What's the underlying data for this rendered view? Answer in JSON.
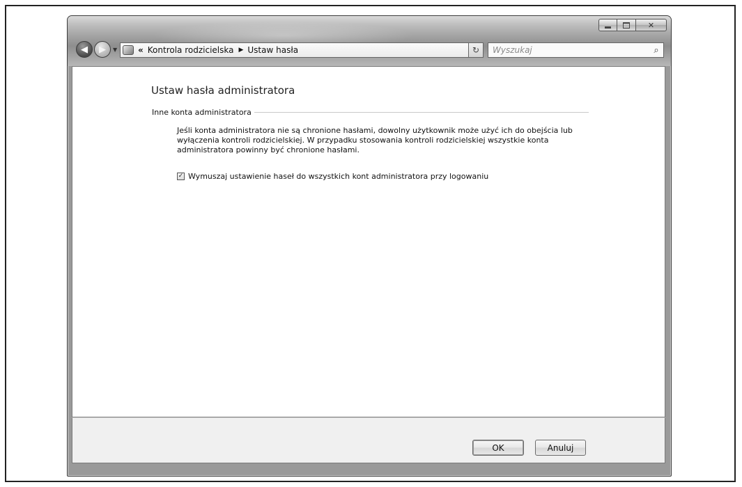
{
  "window": {
    "caption_buttons": {
      "minimize": "minimize-icon",
      "maximize": "maximize-icon",
      "close": "close-icon"
    }
  },
  "toolbar": {
    "back_icon": "arrow-left-icon",
    "forward_icon": "arrow-right-icon",
    "history_icon": "chevron-down-icon"
  },
  "address_bar": {
    "icon": "parental-controls-icon",
    "overflow": "«",
    "crumbs": [
      "Kontrola rodzicielska",
      "Ustaw hasła"
    ],
    "separator": "▶",
    "dropdown_icon": "chevron-down-icon",
    "refresh_icon": "refresh-icon"
  },
  "search": {
    "placeholder": "Wyszukaj",
    "icon": "search-icon"
  },
  "main": {
    "title": "Ustaw hasła administratora",
    "section_heading": "Inne konta administratora",
    "description": "Jeśli konta administratora nie są chronione hasłami, dowolny użytkownik może użyć ich do obejścia lub wyłączenia kontroli rodzicielskiej. W przypadku stosowania kontroli rodzicielskiej wszystkie konta administratora powinny być chronione hasłami.",
    "checkbox": {
      "label": "Wymuszaj ustawienie haseł do wszystkich kont administratora przy logowaniu",
      "checked": true
    }
  },
  "footer": {
    "ok_label": "OK",
    "cancel_label": "Anuluj"
  }
}
